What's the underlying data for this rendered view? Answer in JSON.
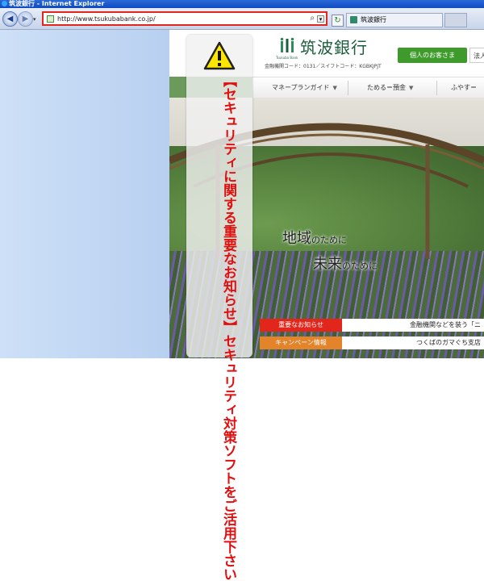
{
  "window": {
    "title": "筑波銀行 - Internet Explorer"
  },
  "toolbar": {
    "back_icon": "back-arrow-icon",
    "forward_icon": "forward-arrow-icon",
    "address_url": "http://www.tsukubabank.co.jp/",
    "search_icon": "magnifier-icon",
    "dropdown_glyph": "▾",
    "refresh_glyph": "↻",
    "tab_title": "筑波銀行"
  },
  "site": {
    "logo_text": "筑波銀行",
    "logo_subtext": "Tsukuba Bank",
    "codes": "金融機関コード：0131／スイフトコード：KGBKJPJT",
    "personal_button": "個人のお客さま",
    "corporate_button": "法人",
    "menu": [
      {
        "label": "マネープランガイド"
      },
      {
        "label": "ためる＝預金"
      },
      {
        "label": "ふやす＝"
      }
    ],
    "headline_line1_main": "地域",
    "headline_line1_rest": "のために",
    "headline_line2_main": "未来",
    "headline_line2_rest": "のために",
    "news": [
      {
        "label": "重要なお知らせ",
        "text": "金融機関などを装う「ニ"
      },
      {
        "label": "キャンペーン情報",
        "text": "つくばのガマぐち支店"
      }
    ]
  },
  "overlay": {
    "text": "【セキュリティに関する重要なお知らせ】セキュリティ対策ソフトをご活用下さい",
    "icon": "warning-triangle-icon"
  },
  "colors": {
    "alert_red": "#e10f0f",
    "address_highlight": "#e1261c",
    "brand_green": "#1c5d3c",
    "personal_green": "#3e9b2b",
    "news_important": "#e3261c",
    "news_campaign": "#e3842a"
  }
}
